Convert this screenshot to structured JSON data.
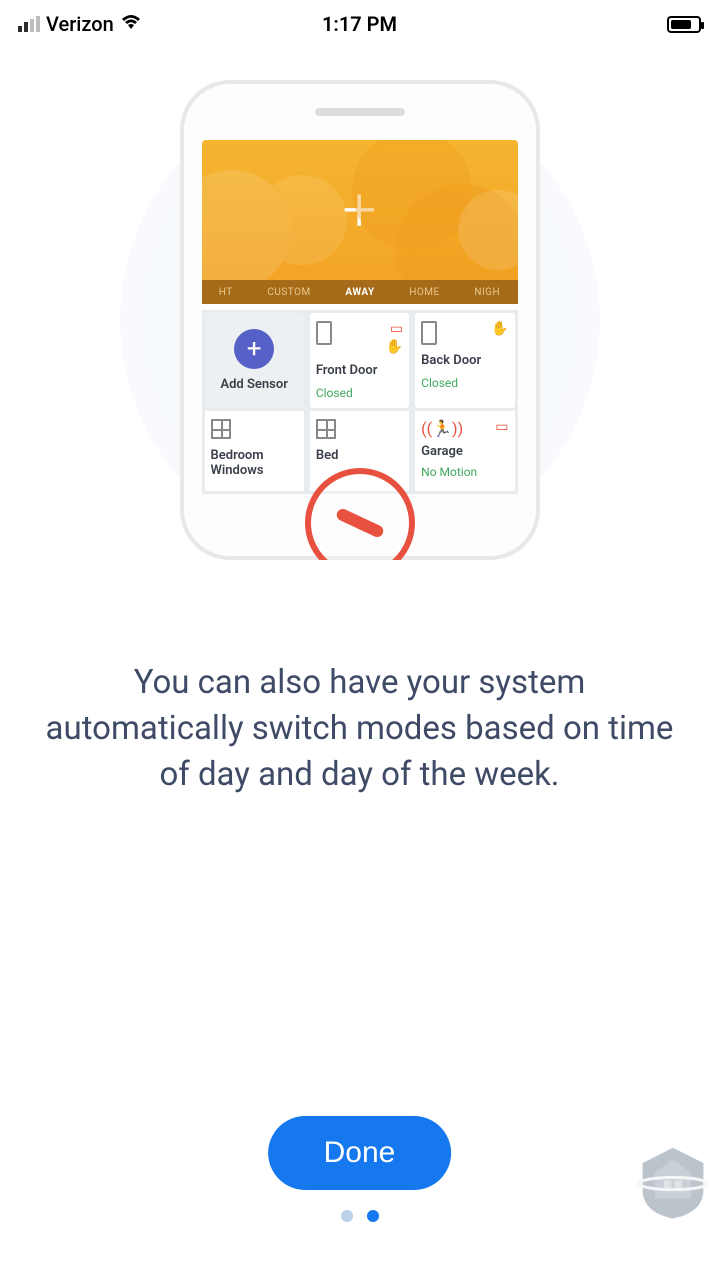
{
  "status_bar": {
    "carrier": "Verizon",
    "time": "1:17 PM"
  },
  "illustration": {
    "modes": {
      "first_partial": "HT",
      "custom": "CUSTOM",
      "away": "AWAY",
      "home": "HOME",
      "last_partial": "NIGH"
    },
    "tiles": {
      "add_sensor": "Add Sensor",
      "front_door": {
        "label": "Front Door",
        "status": "Closed"
      },
      "back_door": {
        "label": "Back Door",
        "status": "Closed"
      },
      "bedroom_windows": {
        "label": "Bedroom Windows"
      },
      "bed_partial": "Bed",
      "garage": {
        "label": "Garage",
        "status": "No Motion"
      }
    }
  },
  "message": "You can also have your system automatically switch modes based on time of day and day of the week.",
  "actions": {
    "done": "Done"
  },
  "pagination": {
    "total": 2,
    "active_index": 1
  }
}
